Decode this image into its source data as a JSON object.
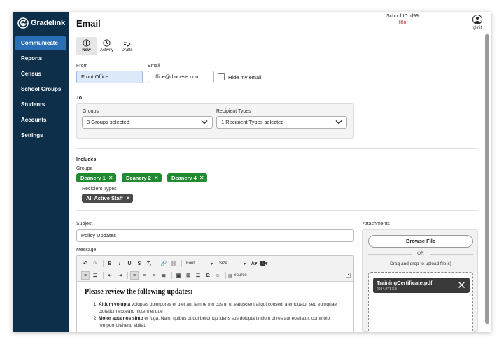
{
  "brand": {
    "name": "Gradelink"
  },
  "sidebar": {
    "items": [
      {
        "label": "Communicate",
        "active": true
      },
      {
        "label": "Reports"
      },
      {
        "label": "Census"
      },
      {
        "label": "School Groups"
      },
      {
        "label": "Students"
      },
      {
        "label": "Accounts"
      },
      {
        "label": "Settings"
      }
    ]
  },
  "header": {
    "title": "Email",
    "school_id": "School ID:  d99",
    "school_code": "ll8n",
    "user_name": "glinit"
  },
  "modes": {
    "new": "New",
    "activity": "Activity",
    "drafts": "Drafts"
  },
  "form": {
    "from_label": "From",
    "from_value": "Front Office",
    "email_label": "Email",
    "email_value": "office@diocese.com",
    "hide_email_label": "Hide my email",
    "to_label": "To",
    "groups_label": "Groups",
    "groups_value": "3 Groups selected",
    "recipient_types_label": "Recipient Types",
    "recipient_types_value": "1 Recipient Types selected"
  },
  "includes": {
    "label": "Includes",
    "groups_label": "Groups",
    "groups": [
      "Deanery 1",
      "Deanery 2",
      "Deanery 4"
    ],
    "recipient_types_label": "Recipient Types",
    "recipient_types": [
      "All Active Staff"
    ]
  },
  "subject": {
    "label": "Subject",
    "value": "Policy Updates"
  },
  "message": {
    "label": "Message",
    "toolbar": {
      "font": "Font",
      "size": "Size",
      "source": "Source"
    },
    "heading": "Please review the following updates:",
    "items": [
      {
        "bold": "Altium volupta",
        "text": " voluptas dolorpores et utet aut lam re mo cus ut ut eatuscient aliqui consedi atemquatur sed eumquae ctotatium excearc hictem et que"
      },
      {
        "bold": "Molor auta nos sinto",
        "text": " et fuga. Nam, quibus ut qui berumqu ideris sus dolupta tincium di res aut eostiatur, commolo remporr orehend ebitat."
      }
    ]
  },
  "attachments": {
    "label": "Attachments",
    "browse": "Browse File",
    "or": "OR",
    "drag": "Drag and drop to upload file(s)",
    "file_name": "TrainingCertificate.pdf",
    "file_size": "2604.071 KB"
  },
  "colors": {
    "sidebar": "#0e2f4a",
    "nav_active": "#2a6fb5",
    "chip_green": "#1f8a2f",
    "chip_dark": "#4a4a4a",
    "school_code": "#c0392b"
  }
}
